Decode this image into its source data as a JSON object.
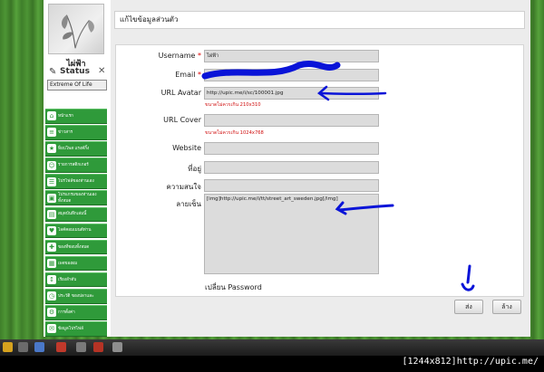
{
  "sidebar": {
    "username": "ไผ่ฟ้า",
    "status_label": "Status",
    "status_value": "Extreme Of Life",
    "menu": [
      {
        "label": "หน้าแรก",
        "icon": "home-icon"
      },
      {
        "label": "ข่าวสาร",
        "icon": "news-icon"
      },
      {
        "label": "ท็อปโพส แรงค์กิ้ง",
        "icon": "star-icon"
      },
      {
        "label": "รายการสติกเกอร์",
        "icon": "sticker-icon"
      },
      {
        "label": "โปรไฟล์ของท่านเอง",
        "icon": "profile-icon"
      },
      {
        "label": "โปรแกรมของท่านเองทั้งหมด",
        "icon": "program-icon"
      },
      {
        "label": "สมุดบันทึกเล่มนี้",
        "icon": "notebook-icon"
      },
      {
        "label": "ไลค์คอมเมนต์ท่าน",
        "icon": "like-icon"
      },
      {
        "label": "ของที่ชอบทั้งหมด",
        "icon": "favorite-icon"
      },
      {
        "label": "เพจของผม",
        "icon": "page-icon"
      },
      {
        "label": "เรียงลำดับ",
        "icon": "sort-icon"
      },
      {
        "label": "ประวัติ ของปลาและ",
        "icon": "history-icon"
      },
      {
        "label": "การตั้งค่า",
        "icon": "settings-icon"
      },
      {
        "label": "ข้อมูลโปรไฟล์",
        "icon": "info-icon"
      }
    ]
  },
  "header": {
    "title": "แก้ไขข้อมูลส่วนตัว"
  },
  "form": {
    "username_label": "Username",
    "username_value": "ไผ่ฟ้า",
    "email_label": "Email",
    "email_value": "",
    "avatar_label": "URL Avatar",
    "avatar_value": "http://upic.me/i/sc/100001.jpg",
    "avatar_hint": "ขนาดไม่ควรเกิน 210x310",
    "cover_label": "URL Cover",
    "cover_value": "",
    "cover_hint": "ขนาดไม่ควรเกิน 1024x768",
    "website_label": "Website",
    "website_value": "",
    "address_label": "ที่อยู่",
    "address_value": "",
    "interest_label": "ความสนใจ",
    "interest_value": "",
    "signature_label": "ลายเซ็น",
    "signature_value": "[img]http://upic.me/i/tt/street_art_sweden.jpg[/img]",
    "change_password": "เปลี่ยน Password",
    "required_mark": "*"
  },
  "buttons": {
    "submit": "ส่ง",
    "clear": "ล้าง"
  },
  "footer": {
    "credit": "[1244x812]http://upic.me/"
  },
  "colors": {
    "menu_green": "#2f9a3a",
    "scribble_blue": "#0a14d8",
    "hint_red": "#d01010"
  }
}
